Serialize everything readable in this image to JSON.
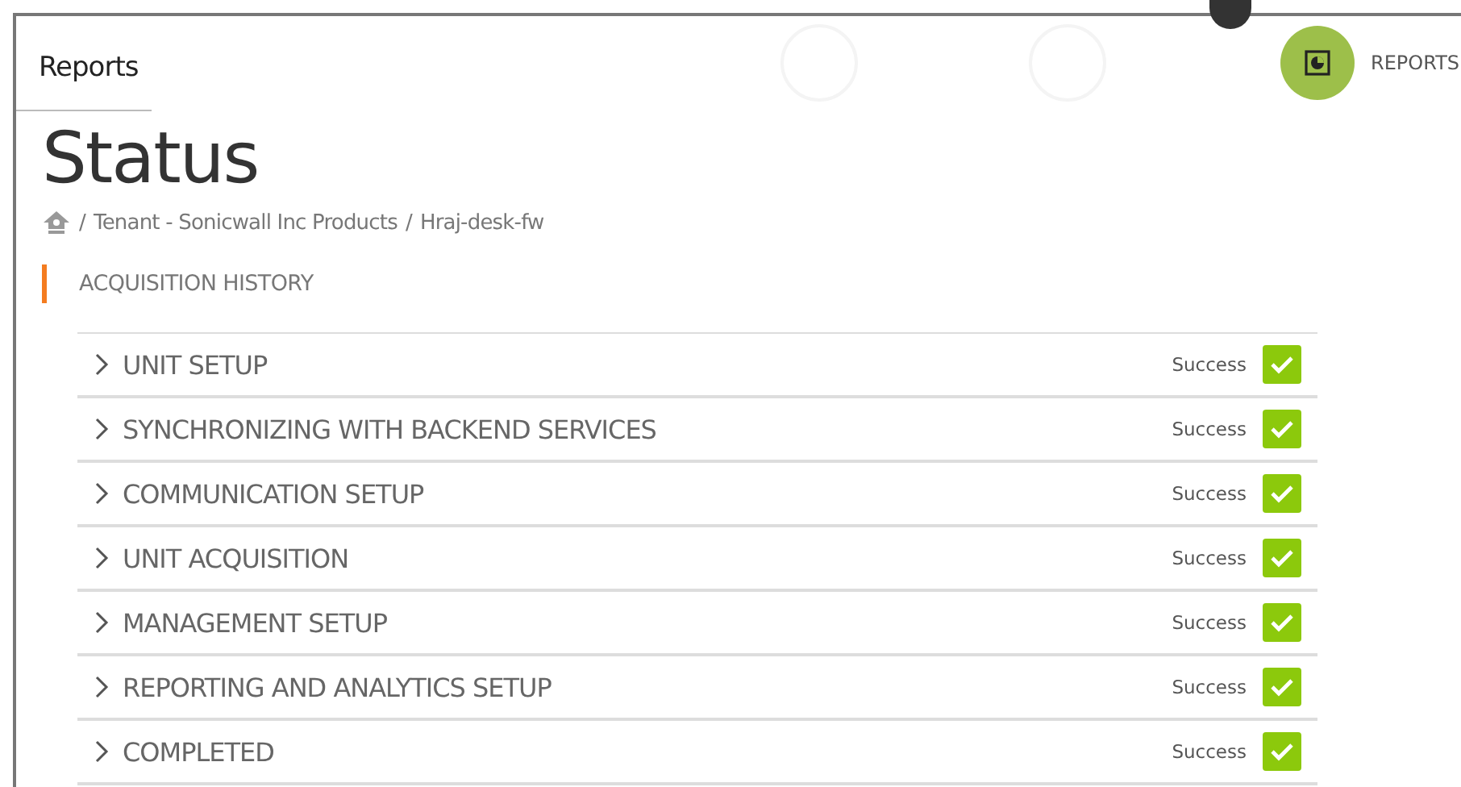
{
  "header": {
    "tab": "Reports",
    "nav": [
      {
        "label": "REPORTS",
        "selected": true
      }
    ]
  },
  "title": "Status",
  "breadcrumb": [
    {
      "sep": "/",
      "label": "Tenant - Sonicwall Inc Products"
    },
    {
      "sep": "/",
      "label": "Hraj-desk-fw"
    }
  ],
  "section": "ACQUISITION HISTORY",
  "steps": [
    {
      "label": "UNIT SETUP",
      "expanded": false,
      "status": "Success",
      "ok": true
    },
    {
      "label": "SYNCHRONIZING WITH BACKEND SERVICES",
      "expanded": false,
      "status": "Success",
      "ok": true
    },
    {
      "label": "COMMUNICATION SETUP",
      "expanded": false,
      "status": "Success",
      "ok": true
    },
    {
      "label": "UNIT ACQUISITION",
      "expanded": false,
      "status": "Success",
      "ok": true
    },
    {
      "label": "MANAGEMENT SETUP",
      "expanded": false,
      "status": "Success",
      "ok": true
    },
    {
      "label": "REPORTING AND ANALYTICS SETUP",
      "expanded": false,
      "status": "Success",
      "ok": true
    },
    {
      "label": "COMPLETED",
      "expanded": false,
      "status": "Success",
      "ok": true
    }
  ]
}
